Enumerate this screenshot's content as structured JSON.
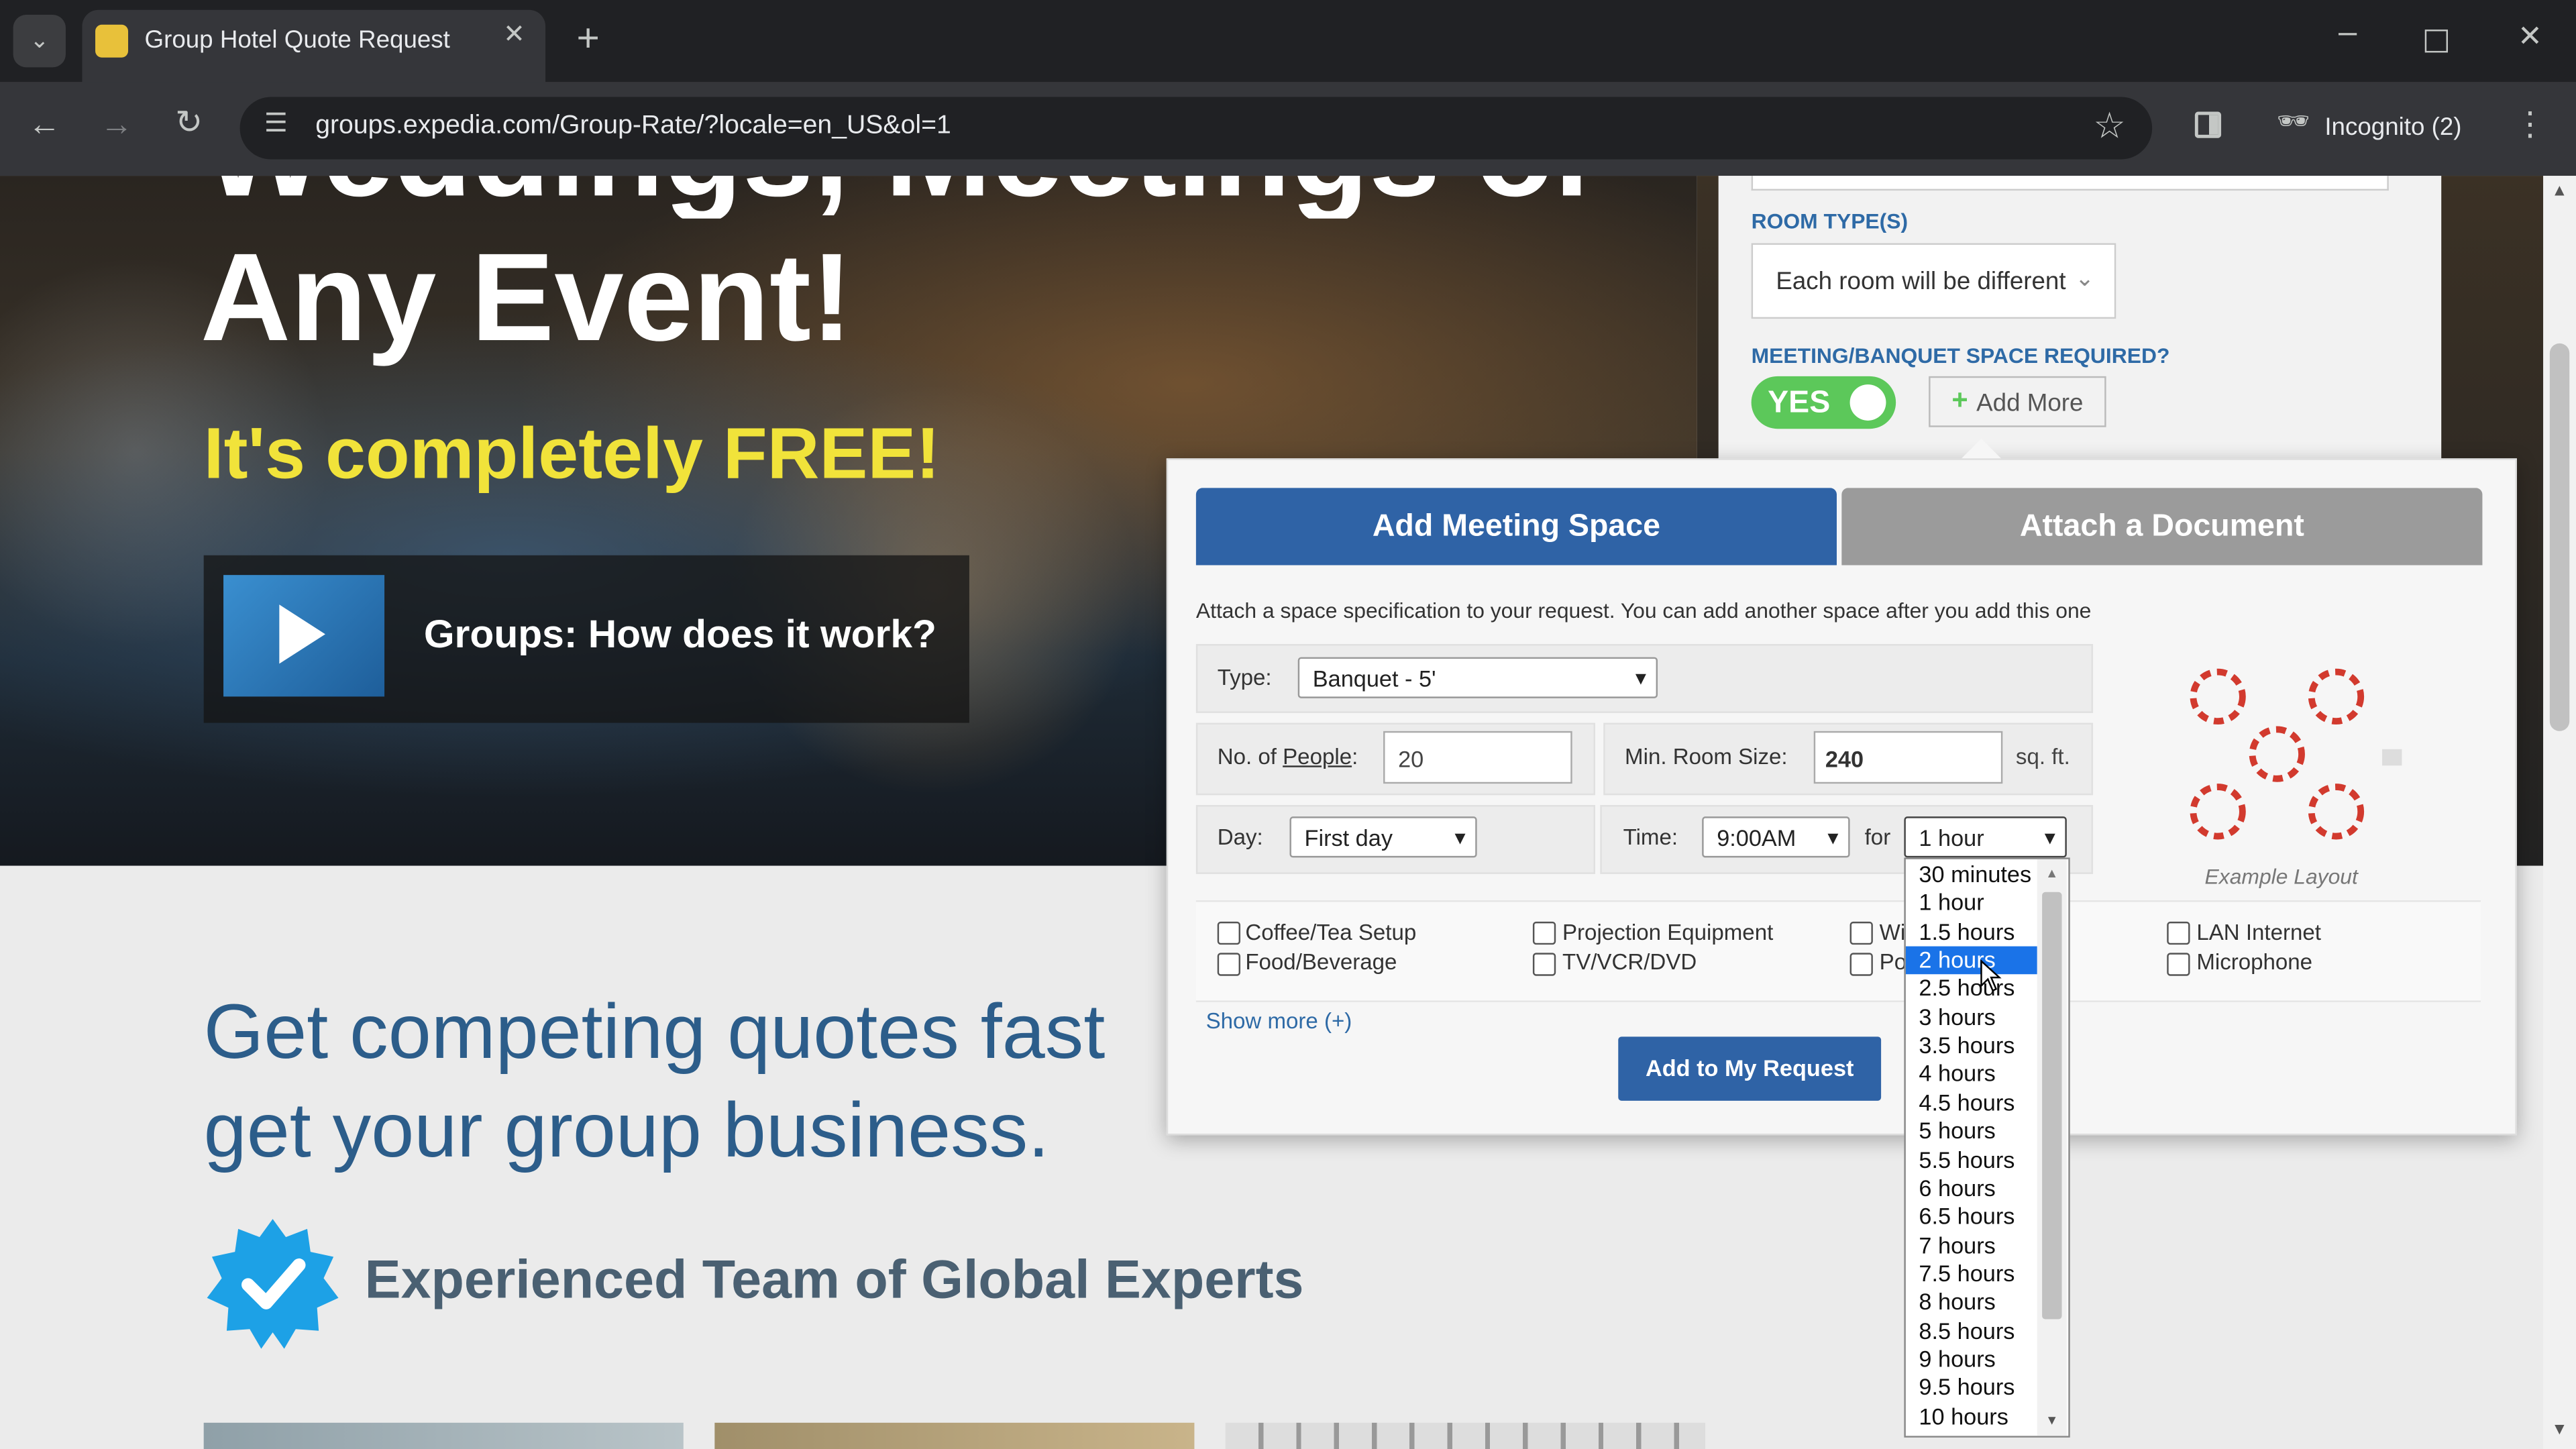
{
  "browser": {
    "tab_title": "Group Hotel Quote Request",
    "url": "groups.expedia.com/Group-Rate/?locale=en_US&ol=1",
    "incognito_label": "Incognito (2)"
  },
  "hero": {
    "title_partial": "Weddings, Meetings or",
    "title_line2": "Any Event!",
    "free_text": "It's completely FREE!",
    "video_label": "Groups: How does it work?"
  },
  "form": {
    "room_types_label": "ROOM TYPE(S)",
    "room_types_value": "Each room will be different",
    "meeting_space_label": "MEETING/BANQUET SPACE REQUIRED?",
    "toggle_label": "YES",
    "add_more_label": "Add More"
  },
  "popup": {
    "tab_add": "Add Meeting Space",
    "tab_attach": "Attach a Document",
    "description": "Attach a space specification to your request. You can add another space after you add this one",
    "type_label": "Type:",
    "type_value": "Banquet - 5'",
    "people_label_prefix": "No. of ",
    "people_label_link": "People",
    "people_label_suffix": ":",
    "people_value": "20",
    "room_size_label": "Min. Room Size:",
    "room_size_value": "240",
    "room_size_unit": "sq. ft.",
    "day_label": "Day:",
    "day_value": "First day",
    "time_label": "Time:",
    "time_value": "9:00AM",
    "for_label": "for",
    "duration_value": "1 hour",
    "example_layout": "Example Layout",
    "checkboxes": [
      "Coffee/Tea Setup",
      "Food/Beverage",
      "Projection Equipment",
      "TV/VCR/DVD",
      "Wi",
      "Po",
      "LAN Internet",
      "Microphone"
    ],
    "show_more": "Show more (+)",
    "submit": "Add to My Request"
  },
  "duration_options": [
    "30 minutes",
    "1 hour",
    "1.5 hours",
    "2 hours",
    "2.5 hours",
    "3 hours",
    "3.5 hours",
    "4 hours",
    "4.5 hours",
    "5 hours",
    "5.5 hours",
    "6 hours",
    "6.5 hours",
    "7 hours",
    "7.5 hours",
    "8 hours",
    "8.5 hours",
    "9 hours",
    "9.5 hours",
    "10 hours"
  ],
  "duration_highlighted": "2 hours",
  "lower": {
    "heading_line1": "Get competing quotes fast",
    "heading_line2": "get your group business.",
    "feature": "Experienced Team of Global Experts"
  },
  "colors": {
    "accent_blue": "#2f63a6",
    "toggle_green": "#5cc85a",
    "free_yellow": "#f1e33a",
    "heading_blue": "#2c5d8a"
  }
}
